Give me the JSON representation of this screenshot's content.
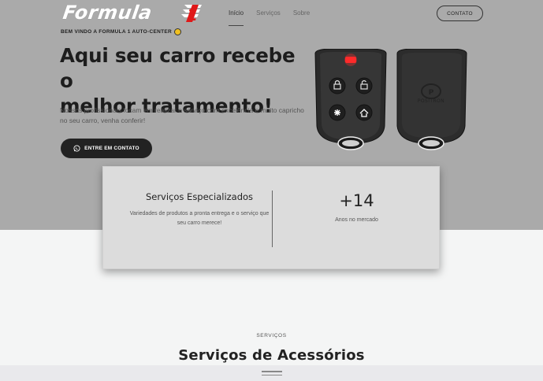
{
  "brand": {
    "logo_text": "Formula",
    "logo_number": "1"
  },
  "nav": {
    "items": [
      {
        "label": "Início",
        "active": true
      },
      {
        "label": "Serviços",
        "active": false
      },
      {
        "label": "Sobre",
        "active": false
      }
    ],
    "contact_label": "CONTATO"
  },
  "hero": {
    "welcome": "BEM VINDO A FORMULA 1 AUTO-CENTER",
    "headline_line1": "Aqui seu carro recebe o",
    "headline_line2": "melhor tratamento!",
    "description": "Nossos profissionais focam em realizar o serviço com excelência e muito capricho no seu carro, venha conferir!",
    "cta_label": "ENTRE EM CONTATO",
    "remote_brand": "POSITRON"
  },
  "card": {
    "title": "Serviços Especializados",
    "text": "Variedades de produtos a pronta entrega e o serviço que seu carro merece!",
    "number": "+14",
    "number_label": "Anos no mercado"
  },
  "services": {
    "kicker": "SERVIÇOS",
    "title": "Serviços de Acessórios"
  },
  "colors": {
    "hero_bg": "#aaaaaa",
    "page_bg": "#f4f5f5",
    "card_bg": "#dcdcdc",
    "dark": "#222222",
    "led_red": "#ff2a2a"
  }
}
